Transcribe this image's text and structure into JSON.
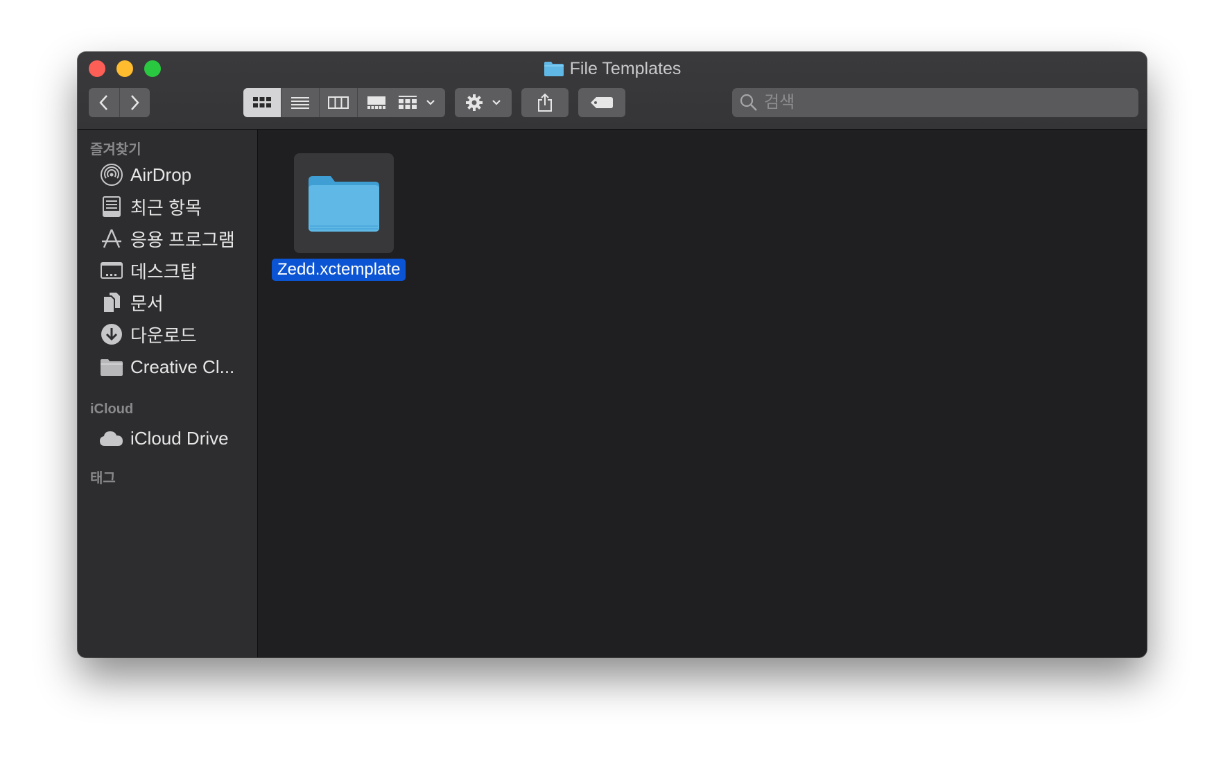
{
  "window": {
    "title": "File Templates"
  },
  "toolbar": {
    "view_modes": [
      "icon",
      "list",
      "column",
      "gallery"
    ],
    "active_view": "icon",
    "search_placeholder": "검색"
  },
  "sidebar": {
    "favorites_header": "즐겨찾기",
    "favorites": [
      {
        "label": "AirDrop",
        "icon": "airdrop-icon"
      },
      {
        "label": "최근 항목",
        "icon": "recents-icon"
      },
      {
        "label": "응용 프로그램",
        "icon": "applications-icon"
      },
      {
        "label": "데스크탑",
        "icon": "desktop-icon"
      },
      {
        "label": "문서",
        "icon": "documents-icon"
      },
      {
        "label": "다운로드",
        "icon": "downloads-icon"
      },
      {
        "label": "Creative Cl...",
        "icon": "folder-icon"
      }
    ],
    "icloud_header": "iCloud",
    "icloud": [
      {
        "label": "iCloud Drive",
        "icon": "cloud-icon"
      }
    ],
    "tags_header": "태그"
  },
  "content": {
    "items": [
      {
        "name": "Zedd.xctemplate",
        "selected": true,
        "icon": "folder-icon"
      }
    ]
  },
  "colors": {
    "window_bg": "#1f1f21",
    "sidebar_bg": "#2d2d2f",
    "selection": "#0b55d4",
    "folder_blue": "#5fb8e6"
  }
}
